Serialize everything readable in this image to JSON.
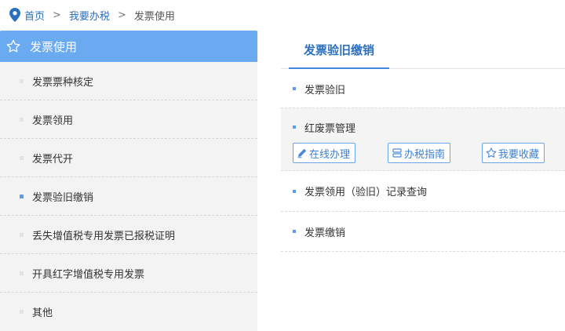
{
  "breadcrumb": {
    "home": "首页",
    "separator": ">",
    "section": "我要办税",
    "current": "发票使用",
    "icon": "location-pin-icon"
  },
  "sidebar": {
    "title": "发票使用",
    "title_icon": "star-icon",
    "items": [
      {
        "label": "发票票种核定"
      },
      {
        "label": "发票领用"
      },
      {
        "label": "发票代开"
      },
      {
        "label": "发票验旧缴销",
        "active": true
      },
      {
        "label": "丢失增值税专用发票已报税证明"
      },
      {
        "label": "开具红字增值税专用发票"
      },
      {
        "label": "其他"
      }
    ]
  },
  "tabs": [
    {
      "label": "发票验旧缴销",
      "active": true
    }
  ],
  "services": [
    {
      "label": "发票验旧"
    },
    {
      "label": "红废票管理",
      "expanded": true,
      "actions": {
        "online": "在线办理",
        "guide": "办税指南",
        "favorite": "我要收藏"
      }
    },
    {
      "label": "发票领用（验旧）记录查询"
    },
    {
      "label": "发票缴销"
    }
  ],
  "colors": {
    "accent": "#6aaaf0",
    "link": "#2b6fbf",
    "active_bullet": "#5d9ce6"
  }
}
